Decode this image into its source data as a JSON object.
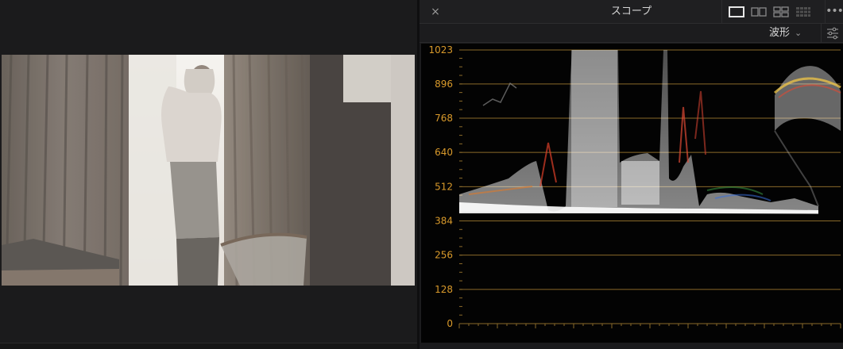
{
  "scope": {
    "close_label": "×",
    "title": "スコープ",
    "mode": "波形",
    "more_label": "•••"
  },
  "waveform": {
    "range": [
      0,
      1023
    ],
    "ticks": [
      "1023",
      "896",
      "768",
      "640",
      "512",
      "384",
      "256",
      "128",
      "0"
    ],
    "grid_color": "#8a6a2a",
    "label_color": "#d99a2b"
  },
  "icons": {
    "close": "close-icon",
    "layout_single": "layout-single-icon",
    "layout_dual": "layout-dual-icon",
    "layout_quad": "layout-quad-icon",
    "layout_grid": "layout-grid-icon",
    "more": "more-dots-icon",
    "settings": "scope-settings-icon",
    "mode_chevron": "chevron-down-icon"
  }
}
